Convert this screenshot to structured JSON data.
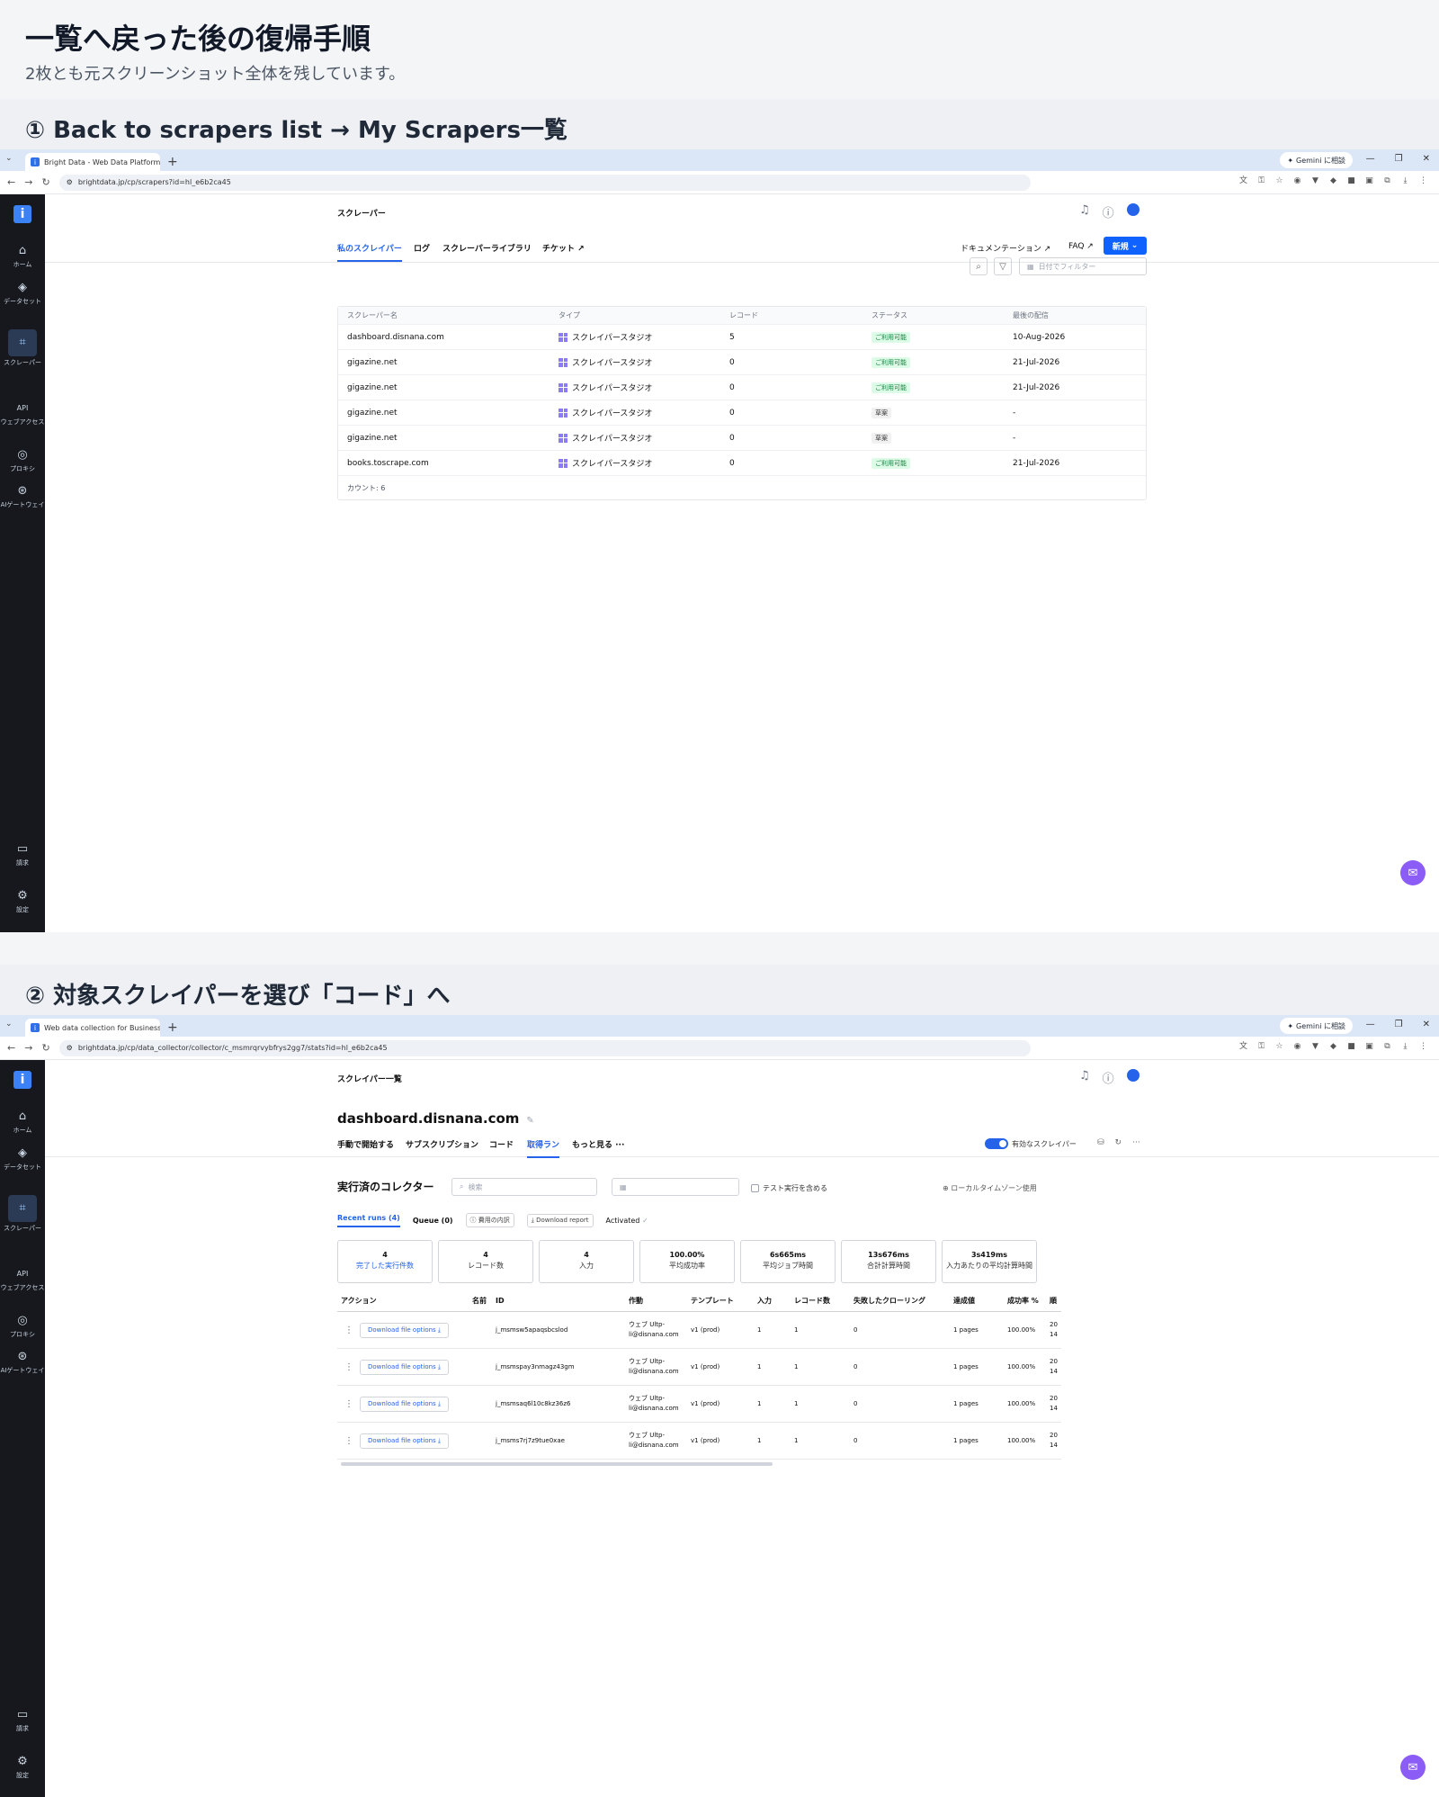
{
  "page": {
    "title": "一覧へ戻った後の復帰手順",
    "subtitle": "2枚とも元スクリーンショット全体を残しています。"
  },
  "section1": {
    "heading": "① Back to scrapers list → My Scrapers一覧"
  },
  "section2": {
    "heading": "② 対象スクレイパーを選び「コード」へ"
  },
  "browser1": {
    "tab_title": "Bright Data - Web Data Platform",
    "url": "brightdata.jp/cp/scrapers?id=hl_e6b2ca45",
    "gemini": "Gemini に相談"
  },
  "browser2": {
    "tab_title": "Web data collection for Business",
    "url": "brightdata.jp/cp/data_collector/collector/c_msmrqrvybfrys2gg7/stats?id=hl_e6b2ca45",
    "gemini": "Gemini に相談"
  },
  "icons": {
    "logo": "i",
    "bell": "bell-icon",
    "help": "help-icon",
    "user": "user-icon",
    "search": "search-icon",
    "filter": "filter-icon",
    "calendar": "calendar-icon",
    "chat": "chat-icon"
  },
  "sidebar": {
    "items": [
      {
        "label": "ホーム",
        "icon": "⌂"
      },
      {
        "label": "データセット",
        "icon": "◈"
      },
      {
        "label": "スクレーパー",
        "icon": "⌗"
      },
      {
        "label": "ウェブアクセス",
        "icon": "API"
      },
      {
        "label": "プロキシ",
        "icon": "◎"
      },
      {
        "label": "AIゲートウェイ",
        "icon": "⊛"
      },
      {
        "label": "請求",
        "icon": "▭"
      },
      {
        "label": "設定",
        "icon": "⚙"
      }
    ]
  },
  "scrapers": {
    "header_title": "スクレーパー",
    "tabs": [
      "私のスクレイパー",
      "ログ",
      "スクレーパーライブラリ",
      "チケット ↗"
    ],
    "docs_link": "ドキュメンテーション ↗",
    "faq_link": "FAQ ↗",
    "new_button": "新規",
    "date_filter_placeholder": "日付でフィルター",
    "columns": [
      "スクレーパー名",
      "タイプ",
      "レコード",
      "ステータス",
      "最後の配信"
    ],
    "rows": [
      {
        "name": "dashboard.disnana.com",
        "type": "スクレイパースタジオ",
        "records": "5",
        "status": "ご利用可能",
        "status_kind": "ok",
        "last": "10-Aug-2026"
      },
      {
        "name": "gigazine.net",
        "type": "スクレイパースタジオ",
        "records": "0",
        "status": "ご利用可能",
        "status_kind": "ok",
        "last": "21-Jul-2026"
      },
      {
        "name": "gigazine.net",
        "type": "スクレイパースタジオ",
        "records": "0",
        "status": "ご利用可能",
        "status_kind": "ok",
        "last": "21-Jul-2026"
      },
      {
        "name": "gigazine.net",
        "type": "スクレイパースタジオ",
        "records": "0",
        "status": "草案",
        "status_kind": "draft",
        "last": "-"
      },
      {
        "name": "gigazine.net",
        "type": "スクレイパースタジオ",
        "records": "0",
        "status": "草案",
        "status_kind": "draft",
        "last": "-"
      },
      {
        "name": "books.toscrape.com",
        "type": "スクレイパースタジオ",
        "records": "0",
        "status": "ご利用可能",
        "status_kind": "ok",
        "last": "21-Jul-2026"
      }
    ],
    "count": "カウント: 6"
  },
  "collector": {
    "header_title": "スクレイパー一覧",
    "name": "dashboard.disnana.com",
    "tabs": [
      "手動で開始する",
      "サブスクリプション",
      "コード",
      "取得ラン",
      "もっと見る ···"
    ],
    "active_tab": "取得ラン",
    "toggle_label": "有効なスクレイパー",
    "section_title": "実行済のコレクター",
    "search_placeholder": "検索",
    "include_test_runs": "テスト実行を含める",
    "local_zone": "ローカルタイムゾーン使用",
    "run_tabs": [
      "Recent runs (4)",
      "Queue (0)",
      "費用の内訳",
      "Download report",
      "Activated"
    ],
    "stats": [
      {
        "value": "4",
        "label": "完了した実行件数"
      },
      {
        "value": "4",
        "label": "レコード数"
      },
      {
        "value": "4",
        "label": "入力"
      },
      {
        "value": "100.00%",
        "label": "平均成功率"
      },
      {
        "value": "6s665ms",
        "label": "平均ジョブ時間"
      },
      {
        "value": "13s676ms",
        "label": "合計計算時間"
      },
      {
        "value": "3s419ms",
        "label": "入力あたりの平均計算時間"
      }
    ],
    "columns": [
      "アクション",
      "名前",
      "ID",
      "作動",
      "テンプレート",
      "入力",
      "レコード数",
      "失敗したクローリング",
      "達成値",
      "成功率 %",
      "順"
    ],
    "download_label": "Download file options ⤓",
    "rows": [
      {
        "id": "j_msmsw5apaqsbcslod",
        "by": "ウェブ Ultp-li@disnana.com",
        "template": "v1 (prod)",
        "inputs": "1",
        "records": "1",
        "failed": "0",
        "achieved": "1 pages",
        "success": "100.00%",
        "order": "20 14"
      },
      {
        "id": "j_msmspay3nmagz43gm",
        "by": "ウェブ Ultp-li@disnana.com",
        "template": "v1 (prod)",
        "inputs": "1",
        "records": "1",
        "failed": "0",
        "achieved": "1 pages",
        "success": "100.00%",
        "order": "20 14"
      },
      {
        "id": "j_msmsaq6l10c8kz36z6",
        "by": "ウェブ Ultp-li@disnana.com",
        "template": "v1 (prod)",
        "inputs": "1",
        "records": "1",
        "failed": "0",
        "achieved": "1 pages",
        "success": "100.00%",
        "order": "20 14"
      },
      {
        "id": "j_msms7rj7z9tue0xae",
        "by": "ウェブ Ultp-li@disnana.com",
        "template": "v1 (prod)",
        "inputs": "1",
        "records": "1",
        "failed": "0",
        "achieved": "1 pages",
        "success": "100.00%",
        "order": "20 14"
      }
    ]
  }
}
